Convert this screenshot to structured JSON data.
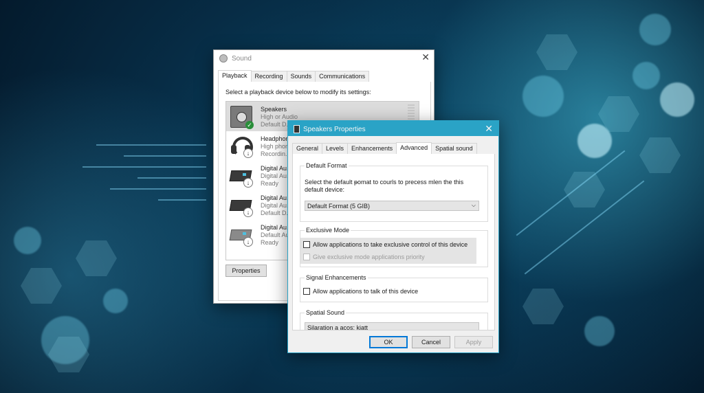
{
  "sound": {
    "title": "Sound",
    "tabs": [
      "Playback",
      "Recording",
      "Sounds",
      "Communications"
    ],
    "instruction": "Select a playback device below to modify its settings:",
    "devices": [
      {
        "name": "Speakers",
        "line2": "High or Audio",
        "line3": "Default D...",
        "icon": "speaker-icon",
        "status": "default-check"
      },
      {
        "name": "Headphon...",
        "line2": "High phon...",
        "line3": "Recordin...",
        "icon": "headphones-icon",
        "status": "download"
      },
      {
        "name": "Digital Au...",
        "line2": "Digital Au...",
        "line3": "Ready",
        "icon": "digital-audio-icon",
        "status": "download"
      },
      {
        "name": "Digital Au...",
        "line2": "Digital Au...",
        "line3": "Default D...",
        "icon": "digital-audio-icon",
        "status": "download"
      },
      {
        "name": "Digital Au...",
        "line2": "Default Au...",
        "line3": "Ready",
        "icon": "digital-audio-icon",
        "status": "download"
      }
    ],
    "properties_button": "Properties"
  },
  "props": {
    "title": "Speakers Properties",
    "tabs": [
      "General",
      "Levels",
      "Enhancements",
      "Advanced",
      "Spatial sound"
    ],
    "active_tab": "Advanced",
    "default_format": {
      "title": "Default Format",
      "description": "Select the default ᵽomat to courls to precess mlen the this default device:",
      "selected": "Default Format (5 GIB)"
    },
    "exclusive_mode": {
      "title": "Exclusive Mode",
      "allow_exclusive": "Allow applications to take exclusive control of this device",
      "give_priority": "Give exclusive mode applications priority"
    },
    "signal_enhancements": {
      "title": "Signal Enhancements",
      "allow_talk": "Allow applications to talk of this device"
    },
    "spatial_sound": {
      "title": "Spatial Sound",
      "selected": "Silaration a acos: kiatt"
    },
    "buttons": {
      "ok": "OK",
      "cancel": "Cancel",
      "apply": "Apply"
    }
  },
  "colors": {
    "accent": "#2aa3c6",
    "check_green": "#2a8f3a"
  }
}
